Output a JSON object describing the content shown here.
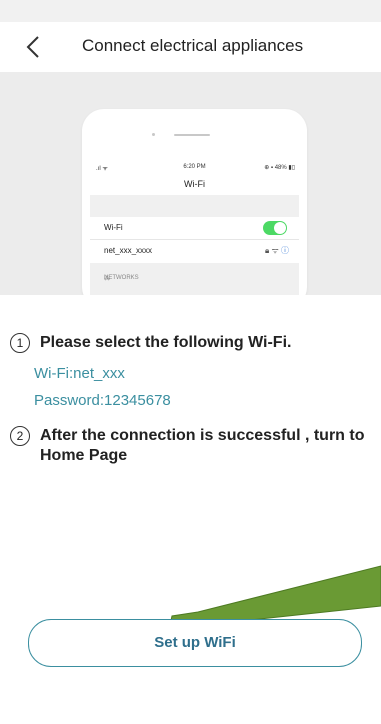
{
  "header": {
    "title": "Connect electrical appliances",
    "back_icon": "chevron-left-icon"
  },
  "illustration": {
    "screen": {
      "time": "6:20 PM",
      "battery": "48%",
      "title": "Wi-Fi",
      "wifi_label": "Wi-Fi",
      "wifi_toggle_on": true,
      "network_name": "net_xxx_xxxx",
      "networks_label": "NETWORKS"
    }
  },
  "steps": [
    {
      "number": "1",
      "text": "Please select the following Wi-Fi."
    },
    {
      "number": "2",
      "text": "After the connection is successful , turn to Home Page"
    }
  ],
  "wifi_info": {
    "wifi": "Wi-Fi:net_xxx",
    "password": "Password:12345678"
  },
  "setup_button": {
    "label": "Set up WiFi"
  },
  "colors": {
    "accent": "#3b8fa0",
    "toggle_green": "#4cd964",
    "arrow_green": "#5f8f2f"
  }
}
